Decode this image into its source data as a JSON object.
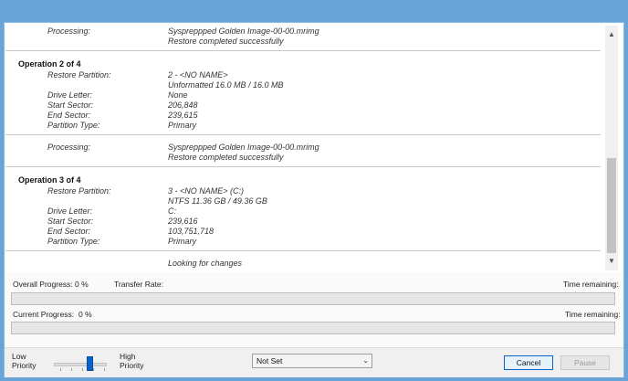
{
  "log": {
    "top": {
      "processing_label": "Processing:",
      "processing_value": "Syspreppped Golden Image-00-00.mrimg",
      "status": "Restore completed successfully"
    },
    "operations": [
      {
        "heading": "Operation 2 of 4",
        "restore_label": "Restore Partition:",
        "restore_value": "2 - <NO NAME>",
        "restore_detail": "Unformatted 16.0 MB / 16.0 MB",
        "drive_label": "Drive Letter:",
        "drive_value": "None",
        "start_label": "Start Sector:",
        "start_value": "206,848",
        "end_label": "End Sector:",
        "end_value": "239,615",
        "type_label": "Partition Type:",
        "type_value": "Primary",
        "processing_label": "Processing:",
        "processing_value": "Syspreppped Golden Image-00-00.mrimg",
        "status": "Restore completed successfully"
      },
      {
        "heading": "Operation 3 of 4",
        "restore_label": "Restore Partition:",
        "restore_value": "3 - <NO NAME> (C:)",
        "restore_detail": "NTFS 11.36 GB / 49.36 GB",
        "drive_label": "Drive Letter:",
        "drive_value": "C:",
        "start_label": "Start Sector:",
        "start_value": "239,616",
        "end_label": "End Sector:",
        "end_value": "103,751,718",
        "type_label": "Partition Type:",
        "type_value": "Primary",
        "status": "Looking for changes"
      }
    ]
  },
  "progress": {
    "overall_label": "Overall Progress:",
    "overall_value": "0 %",
    "overall_fraction": 0,
    "transfer_label": "Transfer Rate:",
    "time_remaining_label": "Time remaining:",
    "current_label": "Current Progress:",
    "current_value": "0 %",
    "current_fraction": 0
  },
  "footer": {
    "low_label_1": "Low",
    "low_label_2": "Priority",
    "high_label_1": "High",
    "high_label_2": "Priority",
    "priority_level": 0.7,
    "select_value": "Not Set",
    "cancel_label": "Cancel",
    "pause_label": "Pause"
  },
  "icons": {
    "scroll_up": "chevron-up-icon",
    "scroll_down": "chevron-down-icon",
    "select_arrow": "chevron-down-icon"
  },
  "colors": {
    "title_bar": "#6aa3d8",
    "accent": "#0a64c8",
    "progress_fill": "#06b025"
  }
}
